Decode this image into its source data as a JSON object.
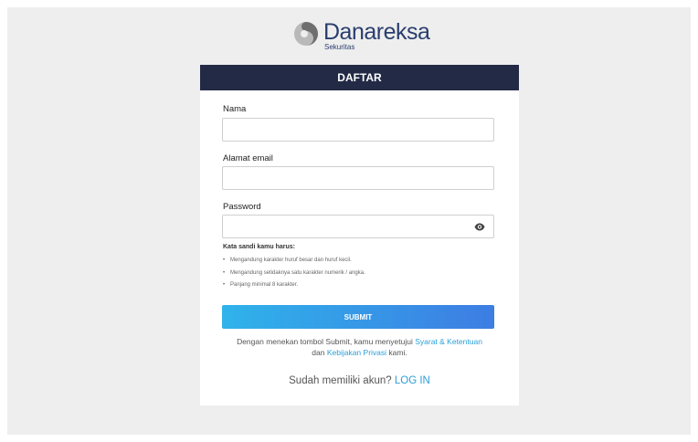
{
  "brand": {
    "name": "Danareksa",
    "subtitle": "Sekuritas",
    "logo_icon": "danareksa-swirl-icon",
    "color": "#2a3e6e"
  },
  "form": {
    "title": "DAFTAR",
    "name_label": "Nama",
    "name_value": "",
    "email_label": "Alamat email",
    "email_value": "",
    "password_label": "Password",
    "password_value": "",
    "password_toggle_icon": "eye-icon"
  },
  "password_rules": {
    "title": "Kata sandi kamu harus:",
    "items": [
      "Mengandung karakter huruf besar dan huruf kecil.",
      "Mengandung setidaknya satu karakter numerik / angka.",
      "Panjang minimal 8 karakter."
    ]
  },
  "submit": {
    "label": "SUBMIT"
  },
  "terms": {
    "prefix": "Dengan menekan tombol Submit, kamu menyetujui",
    "terms_link": "Syarat & Ketentuan",
    "middle": "dan",
    "privacy_link": "Kebijakan Privasi",
    "suffix": "kami."
  },
  "login": {
    "prompt": "Sudah memiliki akun?",
    "link": "LOG IN"
  },
  "colors": {
    "header_bg": "#232a45",
    "accent": "#2a9fd8",
    "button_gradient_start": "#2fb3ea",
    "button_gradient_end": "#3d7de3",
    "page_bg": "#eeeeee"
  }
}
